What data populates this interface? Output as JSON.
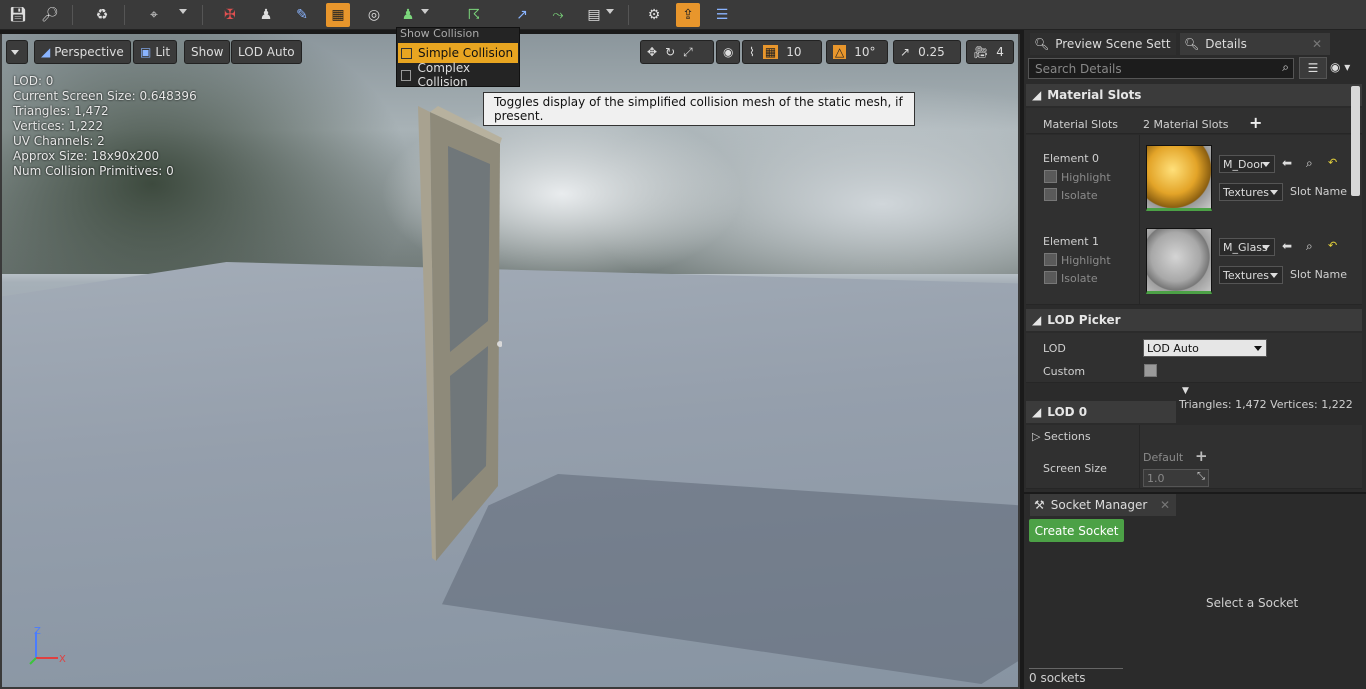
{
  "toolbar": {
    "icons": [
      "save-icon",
      "find-in-browser-icon",
      "reimport-icon",
      "camera-icon",
      "sockets-icon",
      "bones-icon",
      "paint-icon",
      "grid-icon",
      "bounds-icon",
      "collision-icon",
      "pivot-icon",
      "normals-icon",
      "tangents-icon",
      "uv-icon",
      "additional-icon",
      "layers-icon"
    ]
  },
  "viewport": {
    "view_mode": "Perspective",
    "lit": "Lit",
    "show": "Show",
    "lod": "LOD Auto",
    "grid_snap": "10",
    "rot_snap": "10°",
    "scale_snap": "0.25",
    "cam_speed": "4",
    "stats": [
      "LOD:  0",
      "Current Screen Size:  0.648396",
      "Triangles:  1,472",
      "Vertices:  1,222",
      "UV Channels:  2",
      "Approx Size: 18x90x200",
      "Num Collision Primitives:  0"
    ],
    "axis": {
      "z": "Z",
      "x": "X"
    }
  },
  "menu": {
    "header": "Show Collision",
    "items": [
      "Simple Collision",
      "Complex Collision"
    ]
  },
  "tooltip": "Toggles display of the simplified collision mesh of the static mesh, if present.",
  "tabs": {
    "preview": "Preview Scene Sett",
    "details": "Details"
  },
  "search": {
    "placeholder": "Search Details"
  },
  "material_slots": {
    "header": "Material Slots",
    "label": "Material Slots",
    "count": "2 Material Slots",
    "elements": [
      {
        "label": "Element 0",
        "highlight": "Highlight",
        "isolate": "Isolate",
        "material": "M_Door",
        "textures": "Textures",
        "slot": "Slot Name"
      },
      {
        "label": "Element 1",
        "highlight": "Highlight",
        "isolate": "Isolate",
        "material": "M_Glass",
        "textures": "Textures",
        "slot": "Slot Name"
      }
    ]
  },
  "lod_picker": {
    "header": "LOD Picker",
    "lod_label": "LOD",
    "lod_value": "LOD Auto",
    "custom_label": "Custom",
    "tri_info": "Triangles: 1,472    Vertices: 1,222"
  },
  "lod0": {
    "header": "LOD 0",
    "sections": "Sections",
    "screen_size": "Screen Size",
    "default": "Default",
    "value": "1.0"
  },
  "socket": {
    "tab": "Socket Manager",
    "create": "Create Socket",
    "select": "Select a Socket",
    "count": "0 sockets"
  },
  "colors": {
    "accent": "#e8962c",
    "green": "#4ca146",
    "tooltip_bg": "#f0f0f0"
  }
}
